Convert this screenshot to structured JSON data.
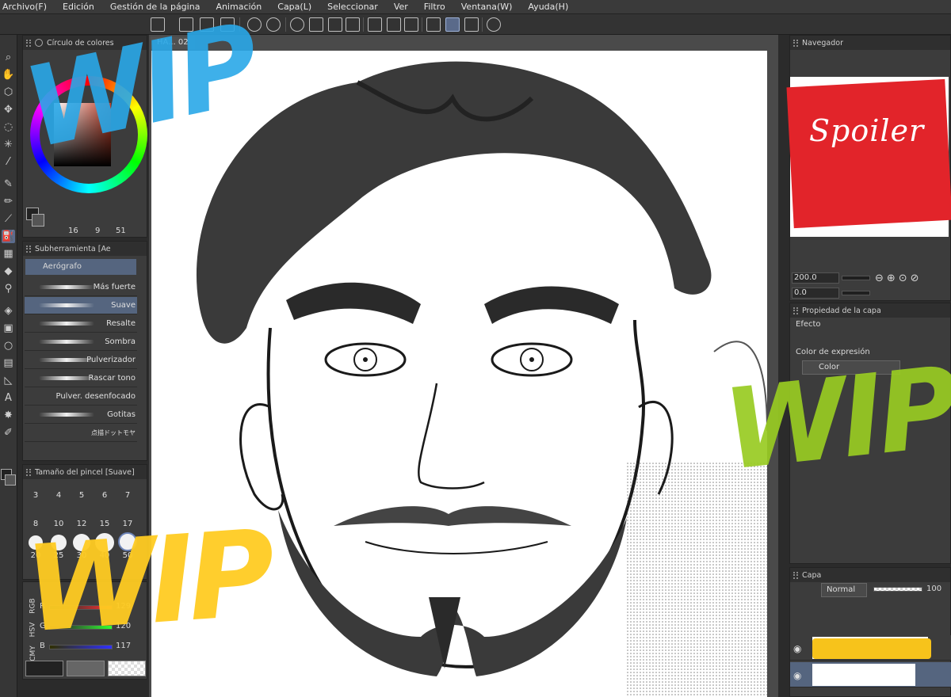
{
  "menu": [
    "Archivo(F)",
    "Edición",
    "Gestión de la página",
    "Animación",
    "Capa(L)",
    "Seleccionar",
    "Ver",
    "Filtro",
    "Ventana(W)",
    "Ayuda(H)"
  ],
  "color_wheel_panel": {
    "title": "Círculo de colores"
  },
  "color_values": {
    "v1": "16",
    "v2": "9",
    "v3": "51"
  },
  "subtool_panel": {
    "title": "Subherramienta [Ae",
    "group": "Aerógrafo"
  },
  "brushes": [
    "Más fuerte",
    "Suave",
    "Resalte",
    "Sombra",
    "Pulverizador",
    "Rascar tono",
    "Pulver. desenfocado",
    "Gotitas",
    "点描ドットモヤ"
  ],
  "brush_size_panel": {
    "title": "Tamaño del pincel [Suave]"
  },
  "brush_sizes": [
    "3",
    "4",
    "5",
    "6",
    "7",
    "8",
    "10",
    "12",
    "15",
    "17",
    "20",
    "25",
    "30",
    "40",
    "50"
  ],
  "color_slider": {
    "modes": [
      "RGB",
      "HSV",
      "CMY"
    ],
    "labels": [
      "R",
      "G",
      "B"
    ],
    "values": [
      "129",
      "120",
      "117"
    ]
  },
  "canvas": {
    "tab": "HA... 02"
  },
  "navigator": {
    "title": "Navegador",
    "zoom": "200.0",
    "rotation": "0.0",
    "preview_text": "Spoiler"
  },
  "layer_property": {
    "title": "Propiedad de la capa",
    "effect_label": "Efecto",
    "expression_label": "Color de expresión",
    "expression_value": "Color"
  },
  "layers": {
    "title": "Capa",
    "blend_mode": "Normal",
    "opacity": "100"
  },
  "watermarks": {
    "top_left": "WIP",
    "bottom_left": "WIP",
    "right": "WIP"
  },
  "colors": {
    "wip_blue": "#2aa8e8",
    "wip_yellow": "#ffcc22",
    "wip_green": "#99cc22",
    "spoiler_red": "#e2242a",
    "accent": "#55657f"
  }
}
